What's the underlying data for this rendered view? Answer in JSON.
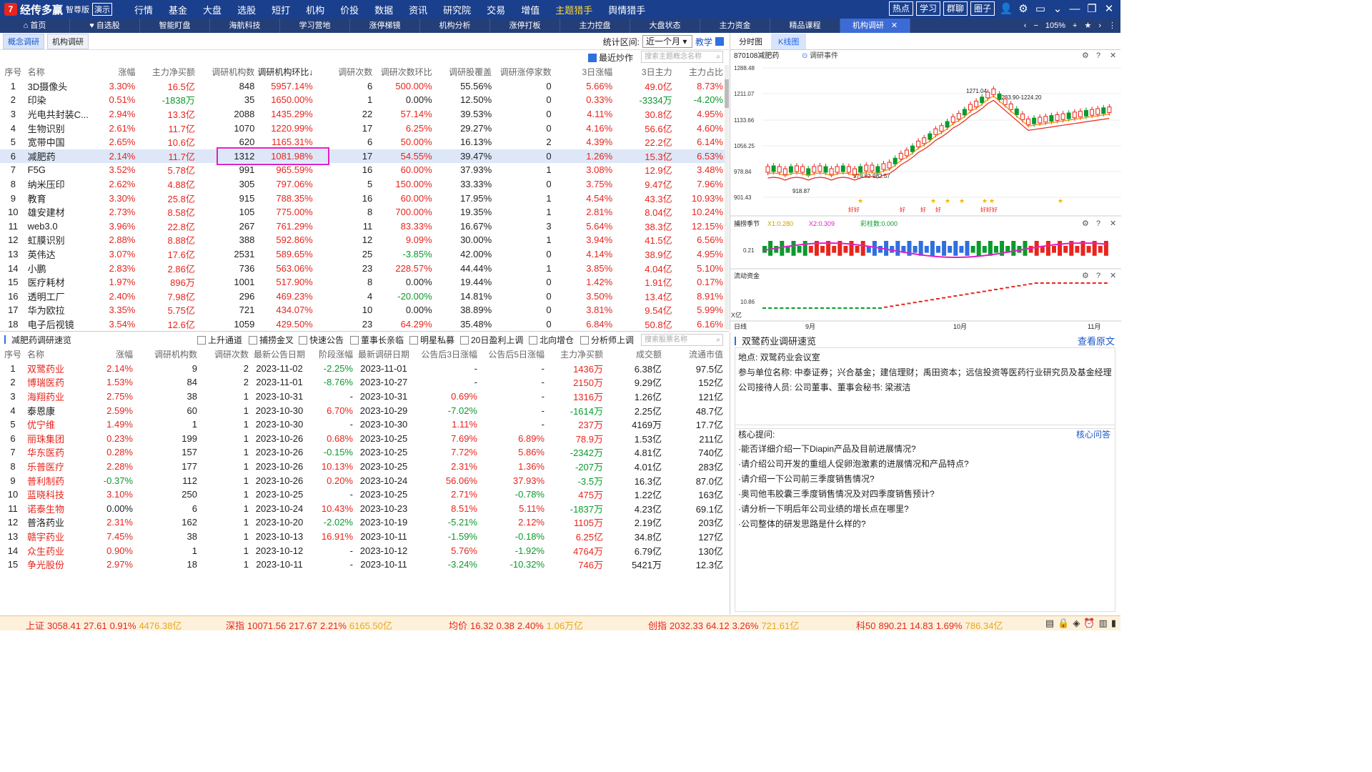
{
  "app": {
    "name": "经传多赢",
    "edition": "智尊版",
    "demo": "演示"
  },
  "menu": [
    {
      "label": "行情"
    },
    {
      "label": "基金"
    },
    {
      "label": "大盘"
    },
    {
      "label": "选股"
    },
    {
      "label": "短打"
    },
    {
      "label": "机构"
    },
    {
      "label": "价投"
    },
    {
      "label": "数据"
    },
    {
      "label": "资讯"
    },
    {
      "label": "研究院"
    },
    {
      "label": "交易"
    },
    {
      "label": "增值"
    },
    {
      "label": "主题猎手"
    },
    {
      "label": "舆情猎手"
    }
  ],
  "top_buttons": [
    "热点",
    "学习",
    "群聊",
    "圈子"
  ],
  "icons": {
    "user": "user-icon",
    "settings": "gear-icon",
    "window": "window-icon",
    "min": "minimize-icon",
    "restore": "restore-icon",
    "close": "close-icon"
  },
  "nav_tabs": [
    {
      "label": "首页"
    },
    {
      "label": "自选股"
    },
    {
      "label": "智能盯盘"
    },
    {
      "label": "海航科技"
    },
    {
      "label": "学习营地"
    },
    {
      "label": "涨停梯镜"
    },
    {
      "label": "机构分析"
    },
    {
      "label": "涨停打板"
    },
    {
      "label": "主力控盘"
    },
    {
      "label": "大盘状态"
    },
    {
      "label": "主力资金"
    },
    {
      "label": "精品课程"
    },
    {
      "label": "机构调研"
    }
  ],
  "nav_zoom": "105%",
  "sub_tabs": [
    "概念调研",
    "机构调研"
  ],
  "period": {
    "label": "统计区间:",
    "value": "近一个月",
    "teach": "教学"
  },
  "recent_hot": "最近炒作",
  "search_theme_placeholder": "搜索主题概念名称",
  "top_table": {
    "headers": [
      "序号",
      "名称",
      "涨幅",
      "主力净买额",
      "调研机构数",
      "调研机构环比↓",
      "调研次数",
      "调研次数环比",
      "调研股覆盖",
      "调研涨停家数",
      "3日涨幅",
      "3日主力",
      "主力占比"
    ],
    "rows": [
      [
        "1",
        "3D摄像头",
        "3.30%",
        "16.5亿",
        "848",
        "5957.14%",
        "6",
        "500.00%",
        "55.56%",
        "0",
        "5.66%",
        "49.0亿",
        "8.73%"
      ],
      [
        "2",
        "印染",
        "0.51%",
        "-1838万",
        "35",
        "1650.00%",
        "1",
        "0.00%",
        "12.50%",
        "0",
        "0.33%",
        "-3334万",
        "-4.20%"
      ],
      [
        "3",
        "光电共封装C...",
        "2.94%",
        "13.3亿",
        "2088",
        "1435.29%",
        "22",
        "57.14%",
        "39.53%",
        "0",
        "4.11%",
        "30.8亿",
        "4.95%"
      ],
      [
        "4",
        "生物识别",
        "2.61%",
        "11.7亿",
        "1070",
        "1220.99%",
        "17",
        "6.25%",
        "29.27%",
        "0",
        "4.16%",
        "56.6亿",
        "4.60%"
      ],
      [
        "5",
        "宽带中国",
        "2.65%",
        "10.6亿",
        "620",
        "1165.31%",
        "6",
        "50.00%",
        "16.13%",
        "2",
        "4.39%",
        "22.2亿",
        "6.14%"
      ],
      [
        "6",
        "减肥药",
        "2.14%",
        "11.7亿",
        "1312",
        "1081.98%",
        "17",
        "54.55%",
        "39.47%",
        "0",
        "1.26%",
        "15.3亿",
        "6.53%"
      ],
      [
        "7",
        "F5G",
        "3.52%",
        "5.78亿",
        "991",
        "965.59%",
        "16",
        "60.00%",
        "37.93%",
        "1",
        "3.08%",
        "12.9亿",
        "3.48%"
      ],
      [
        "8",
        "纳米压印",
        "2.62%",
        "4.88亿",
        "305",
        "797.06%",
        "5",
        "150.00%",
        "33.33%",
        "0",
        "3.75%",
        "9.47亿",
        "7.96%"
      ],
      [
        "9",
        "教育",
        "3.30%",
        "25.8亿",
        "915",
        "788.35%",
        "16",
        "60.00%",
        "17.95%",
        "1",
        "4.54%",
        "43.3亿",
        "10.93%"
      ],
      [
        "10",
        "雄安建材",
        "2.73%",
        "8.58亿",
        "105",
        "775.00%",
        "8",
        "700.00%",
        "19.35%",
        "1",
        "2.81%",
        "8.04亿",
        "10.24%"
      ],
      [
        "11",
        "web3.0",
        "3.96%",
        "22.8亿",
        "267",
        "761.29%",
        "11",
        "83.33%",
        "16.67%",
        "3",
        "5.64%",
        "38.3亿",
        "12.15%"
      ],
      [
        "12",
        "虹膜识别",
        "2.88%",
        "8.88亿",
        "388",
        "592.86%",
        "12",
        "9.09%",
        "30.00%",
        "1",
        "3.94%",
        "41.5亿",
        "6.56%"
      ],
      [
        "13",
        "英伟达",
        "3.07%",
        "17.6亿",
        "2531",
        "589.65%",
        "25",
        "-3.85%",
        "42.00%",
        "0",
        "4.14%",
        "38.9亿",
        "4.95%"
      ],
      [
        "14",
        "小鹏",
        "2.83%",
        "2.86亿",
        "736",
        "563.06%",
        "23",
        "228.57%",
        "44.44%",
        "1",
        "3.85%",
        "4.04亿",
        "5.10%"
      ],
      [
        "15",
        "医疗耗材",
        "1.97%",
        "896万",
        "1001",
        "517.90%",
        "8",
        "0.00%",
        "19.44%",
        "0",
        "1.42%",
        "1.91亿",
        "0.17%"
      ],
      [
        "16",
        "透明工厂",
        "2.40%",
        "7.98亿",
        "296",
        "469.23%",
        "4",
        "-20.00%",
        "14.81%",
        "0",
        "3.50%",
        "13.4亿",
        "8.91%"
      ],
      [
        "17",
        "华为欧拉",
        "3.35%",
        "5.75亿",
        "721",
        "434.07%",
        "10",
        "0.00%",
        "38.89%",
        "0",
        "3.81%",
        "9.54亿",
        "5.99%"
      ],
      [
        "18",
        "电子后视镜",
        "3.54%",
        "12.6亿",
        "1059",
        "429.50%",
        "23",
        "64.29%",
        "35.48%",
        "0",
        "6.84%",
        "50.8亿",
        "6.16%"
      ]
    ]
  },
  "bottom_section": {
    "title": "减肥药调研速览",
    "filters": [
      "上升通道",
      "捕捞金叉",
      "快速公告",
      "董事长亲临",
      "明星私募",
      "20日盈利上调",
      "北向增仓",
      "分析师上调"
    ],
    "search_placeholder": "搜索股票名称",
    "headers": [
      "序号",
      "名称",
      "涨幅",
      "调研机构数",
      "调研次数",
      "最新公告日期",
      "阶段涨幅",
      "最新调研日期",
      "公告后3日涨幅",
      "公告后5日涨幅",
      "主力净买额",
      "成交额",
      "流通市值"
    ],
    "rows": [
      [
        "1",
        "双鹭药业",
        "2.14%",
        "9",
        "2",
        "2023-11-02",
        "-2.25%",
        "2023-11-01",
        "-",
        "-",
        "1436万",
        "6.38亿",
        "97.5亿"
      ],
      [
        "2",
        "博瑞医药",
        "1.53%",
        "84",
        "2",
        "2023-11-01",
        "-8.76%",
        "2023-10-27",
        "-",
        "-",
        "2150万",
        "9.29亿",
        "152亿"
      ],
      [
        "3",
        "海翔药业",
        "2.75%",
        "38",
        "1",
        "2023-10-31",
        "-",
        "2023-10-31",
        "0.69%",
        "-",
        "1316万",
        "1.26亿",
        "121亿"
      ],
      [
        "4",
        "泰恩康",
        "2.59%",
        "60",
        "1",
        "2023-10-30",
        "6.70%",
        "2023-10-29",
        "-7.02%",
        "-",
        "-1614万",
        "2.25亿",
        "48.7亿"
      ],
      [
        "5",
        "优宁维",
        "1.49%",
        "1",
        "1",
        "2023-10-30",
        "-",
        "2023-10-30",
        "1.11%",
        "-",
        "237万",
        "4169万",
        "17.7亿"
      ],
      [
        "6",
        "丽珠集团",
        "0.23%",
        "199",
        "1",
        "2023-10-26",
        "0.68%",
        "2023-10-25",
        "7.69%",
        "6.89%",
        "78.9万",
        "1.53亿",
        "211亿"
      ],
      [
        "7",
        "华东医药",
        "0.28%",
        "157",
        "1",
        "2023-10-26",
        "-0.15%",
        "2023-10-25",
        "7.72%",
        "5.86%",
        "-2342万",
        "4.81亿",
        "740亿"
      ],
      [
        "8",
        "乐普医疗",
        "2.28%",
        "177",
        "1",
        "2023-10-26",
        "10.13%",
        "2023-10-25",
        "2.31%",
        "1.36%",
        "-207万",
        "4.01亿",
        "283亿"
      ],
      [
        "9",
        "普利制药",
        "-0.37%",
        "112",
        "1",
        "2023-10-26",
        "0.20%",
        "2023-10-24",
        "56.06%",
        "37.93%",
        "-3.5万",
        "16.3亿",
        "87.0亿"
      ],
      [
        "10",
        "蓝晓科技",
        "3.10%",
        "250",
        "1",
        "2023-10-25",
        "-",
        "2023-10-25",
        "2.71%",
        "-0.78%",
        "475万",
        "1.22亿",
        "163亿"
      ],
      [
        "11",
        "诺泰生物",
        "0.00%",
        "6",
        "1",
        "2023-10-24",
        "10.43%",
        "2023-10-23",
        "8.51%",
        "5.11%",
        "-1837万",
        "4.23亿",
        "69.1亿"
      ],
      [
        "12",
        "普洛药业",
        "2.31%",
        "162",
        "1",
        "2023-10-20",
        "-2.02%",
        "2023-10-19",
        "-5.21%",
        "2.12%",
        "1105万",
        "2.19亿",
        "203亿"
      ],
      [
        "13",
        "赣宇药业",
        "7.45%",
        "38",
        "1",
        "2023-10-13",
        "16.91%",
        "2023-10-11",
        "-1.59%",
        "-0.18%",
        "6.25亿",
        "34.8亿",
        "127亿"
      ],
      [
        "14",
        "众生药业",
        "0.90%",
        "1",
        "1",
        "2023-10-12",
        "-",
        "2023-10-12",
        "5.76%",
        "-1.92%",
        "4764万",
        "6.79亿",
        "130亿"
      ],
      [
        "15",
        "争光股份",
        "2.97%",
        "18",
        "1",
        "2023-10-11",
        "-",
        "2023-10-11",
        "-3.24%",
        "-10.32%",
        "746万",
        "5421万",
        "12.3亿"
      ]
    ]
  },
  "right_chart": {
    "tabs": [
      "分时图",
      "K线图"
    ],
    "code_name": "870108减肥药",
    "event_label": "调研事件",
    "price_ticks": [
      "1288.48",
      "1211.07",
      "1133.66",
      "1056.25",
      "978.84",
      "901.43"
    ],
    "price_annotations": [
      "1271.04",
      "1233.90-1224.20",
      "979.82-982.57",
      "918.87"
    ],
    "good_markers": [
      "好好",
      "好",
      "好",
      "好",
      "好好好"
    ],
    "ind1": {
      "name": "捕捞季节",
      "x1": "X1:0.280",
      "x2": "X2:0.309",
      "bar": "彩柱数:0.000",
      "tick": "0.21"
    },
    "ind2": {
      "name": "流动资金",
      "tick": "10.86",
      "unit": "X亿"
    },
    "date_label": "日线",
    "months": [
      "9月",
      "10月",
      "11月"
    ]
  },
  "info_panel": {
    "title": "双鹭药业调研速览",
    "view_link": "查看原文",
    "location": "地点: 双鹭药业会议室",
    "participants": "参与单位名称: 中泰证券；兴合基金；建信理财；禹田资本；远信投资等医药行业研究员及基金经理",
    "host": "公司接待人员: 公司董事、董事会秘书: 梁淑洁",
    "questions_label": "核心提问:",
    "qa_link": "核心问答",
    "questions": [
      "·能否详细介绍一下Diapin产品及目前进展情况?",
      "·请介绍公司开发的重组人促卵泡激素的进展情况和产品特点?",
      "·请介绍一下公司前三季度销售情况?",
      "·奥司他韦胶囊三季度销售情况及对四季度销售预计?",
      "·请分析一下明后年公司业绩的增长点在哪里?",
      "·公司整体的研发思路是什么样的?"
    ]
  },
  "status_bar": [
    {
      "name": "上证",
      "price": "3058.41",
      "chg": "27.61",
      "pct": "0.91%",
      "amt": "4476.38亿"
    },
    {
      "name": "深指",
      "price": "10071.56",
      "chg": "217.67",
      "pct": "2.21%",
      "amt": "6165.50亿"
    },
    {
      "name": "均价",
      "price": "16.32",
      "chg": "0.38",
      "pct": "2.40%",
      "amt": "1.06万亿"
    },
    {
      "name": "创指",
      "price": "2032.33",
      "chg": "64.12",
      "pct": "3.26%",
      "amt": "721.61亿"
    },
    {
      "name": "科50",
      "price": "890.21",
      "chg": "14.83",
      "pct": "1.69%",
      "amt": "786.34亿"
    }
  ]
}
